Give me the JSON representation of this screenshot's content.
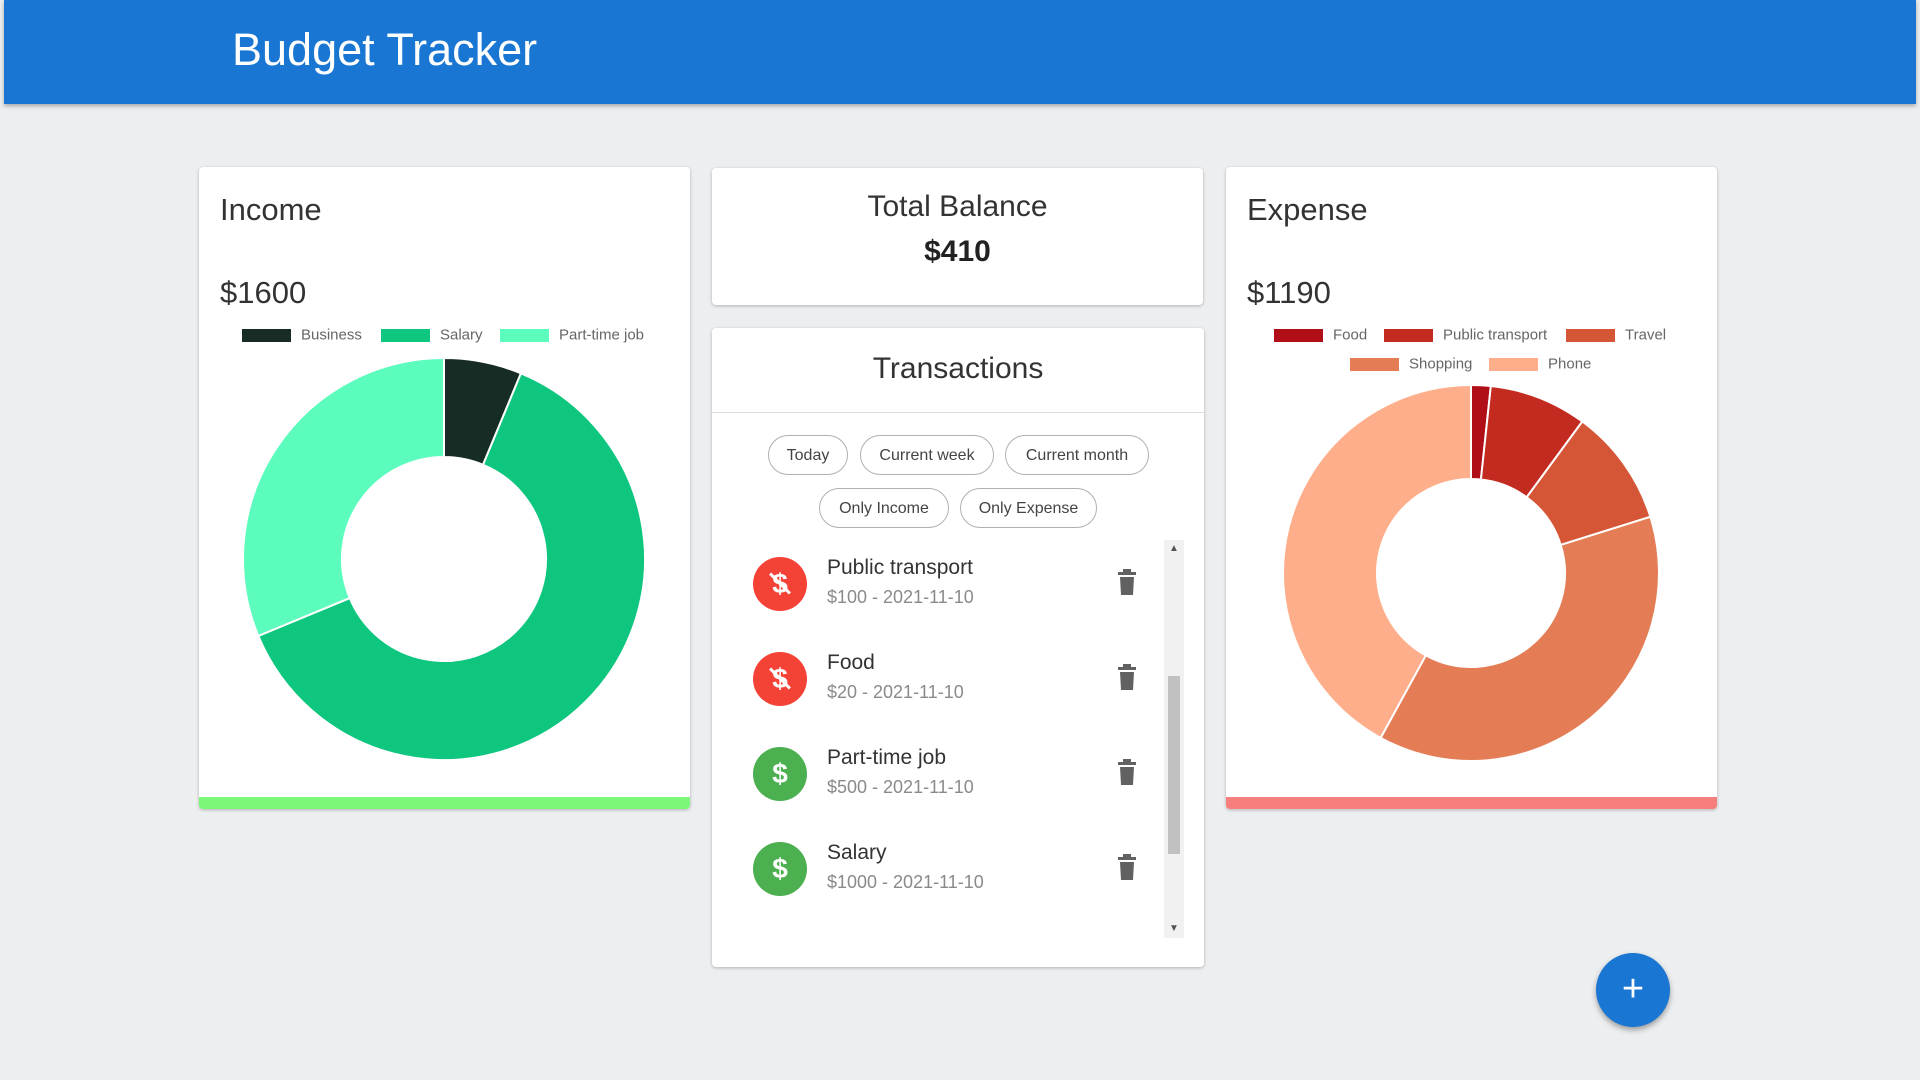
{
  "app": {
    "title": "Budget Tracker"
  },
  "income": {
    "title": "Income",
    "amount": "$1600",
    "chart_data": {
      "type": "pie",
      "categories": [
        "Business",
        "Salary",
        "Part-time job"
      ],
      "values": [
        100,
        1000,
        500
      ],
      "colors": [
        "#162c24",
        "#0fc67e",
        "#5cfcbd"
      ]
    }
  },
  "balance": {
    "label": "Total Balance",
    "value": "$410"
  },
  "expense": {
    "title": "Expense",
    "amount": "$1190",
    "chart_data": {
      "type": "pie",
      "categories": [
        "Food",
        "Public transport",
        "Travel",
        "Shopping",
        "Phone"
      ],
      "values": [
        20,
        100,
        120,
        450,
        500
      ],
      "colors": [
        "#b10f17",
        "#c42b20",
        "#d55637",
        "#e47d56",
        "#feae8a"
      ]
    }
  },
  "transactions": {
    "title": "Transactions",
    "filters": [
      "Today",
      "Current week",
      "Current month",
      "Only Income",
      "Only Expense"
    ],
    "items": [
      {
        "name": "Public transport",
        "meta": "$100 - 2021-11-10",
        "type": "expense",
        "icon": "dollar-off-icon"
      },
      {
        "name": "Food",
        "meta": "$20 - 2021-11-10",
        "type": "expense",
        "icon": "dollar-off-icon"
      },
      {
        "name": "Part-time job",
        "meta": "$500 - 2021-11-10",
        "type": "income",
        "icon": "dollar-icon"
      },
      {
        "name": "Salary",
        "meta": "$1000 - 2021-11-10",
        "type": "income",
        "icon": "dollar-icon"
      }
    ]
  },
  "fab": {
    "label": "+",
    "icon": "add-icon"
  }
}
